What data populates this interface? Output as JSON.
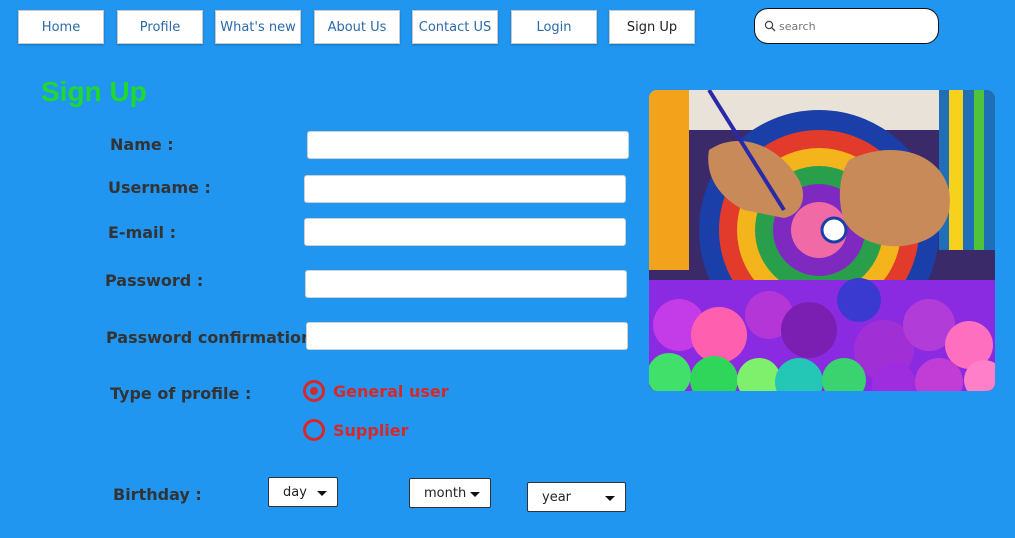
{
  "nav": {
    "items": [
      {
        "label": "Home"
      },
      {
        "label": "Profile"
      },
      {
        "label": "What's new"
      },
      {
        "label": "About Us"
      },
      {
        "label": "Contact US"
      },
      {
        "label": "Login"
      },
      {
        "label": "Sign Up"
      }
    ],
    "active": "Sign Up"
  },
  "search": {
    "placeholder": "search",
    "icon": "search-icon"
  },
  "page": {
    "title": "Sign Up",
    "title_color": "#1ed92e",
    "background": "#2196f0"
  },
  "form": {
    "name_label": "Name  :",
    "username_label": "Username :",
    "email_label": "E-mail :",
    "password_label": "Password :",
    "password_confirm_label": "Password confirmation :",
    "profile_type_label": "Type of profile :",
    "profile_options": [
      {
        "label": "General user",
        "checked": true
      },
      {
        "label": "Supplier",
        "checked": false
      }
    ],
    "birthday_label": "Birthday   :",
    "birthday": {
      "day": "day",
      "month": "month",
      "year": "year"
    },
    "accent_color": "#d62828"
  },
  "image": {
    "description_icon": "craft-photo"
  }
}
